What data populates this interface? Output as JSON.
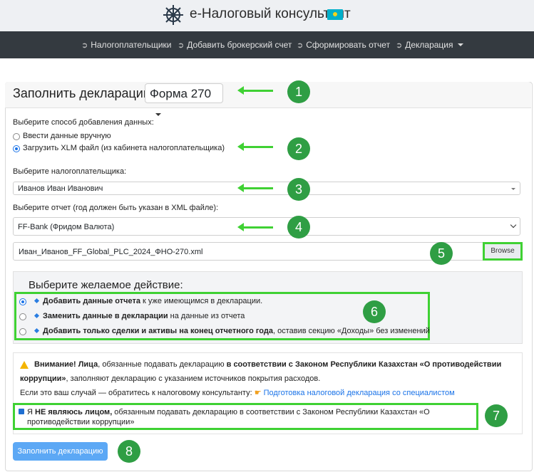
{
  "header": {
    "app_title": "e-Налоговый консультант"
  },
  "nav": {
    "items": [
      {
        "label": "Налогоплательщики"
      },
      {
        "label": "Добавить брокерский счет"
      },
      {
        "label": "Сформировать отчет"
      },
      {
        "label": "Декларация"
      }
    ]
  },
  "form": {
    "title": "Заполнить декларацию",
    "form_select": "Форма 270",
    "data_method_label": "Выберите способ добавления данных:",
    "method_options": [
      {
        "label": "Ввести данные вручную",
        "selected": false
      },
      {
        "label": "Загрузить XLM файл (из кабинета налогоплательщика)",
        "selected": true
      }
    ],
    "taxpayer_label": "Выберите налогоплательщика:",
    "taxpayer_value": "Иванов Иван Иванович",
    "report_label": "Выберите отчет (год должен быть указан в XML файле):",
    "report_value": "FF-Bank (Фридом Валюта)",
    "file_name": "Иван_Иванов_FF_Global_PLC_2024_ФНО-270.xml",
    "browse_label": "Browse"
  },
  "actions": {
    "title": "Выберите желаемое действие:",
    "options": [
      {
        "bold": "Добавить данные отчета",
        "rest": " к уже имеющимся в декларации.",
        "selected": true
      },
      {
        "bold": "Заменить данные в декларации",
        "rest": " на данные из отчета",
        "selected": false
      },
      {
        "bold": "Добавить только сделки и активы на конец отчетного года",
        "rest": ", оставив секцию «Доходы» без изменений",
        "selected": false
      }
    ]
  },
  "warning": {
    "bold1": "Внимание! Лица",
    "text1": ", обязанные подавать декларацию ",
    "bold2": "в соответствии с Законом Республики Казахстан «О противодействии коррупции»",
    "text2": ", заполняют декларацию с указанием источников покрытия расходов.",
    "line2": "Если это ваш случай — обратитесь к налоговому консультанту:",
    "link": "Подготовка налоговой декларация со специалистом",
    "check_prefix": "Я ",
    "check_bold": "НЕ являюсь лицом,",
    "check_rest": " обязанным подавать декларацию в соответствии с Законом Республики Казахстан «О противодействии коррупции»"
  },
  "submit_label": "Заполнить декларацию",
  "annotations": [
    "1",
    "2",
    "3",
    "4",
    "5",
    "6",
    "7",
    "8"
  ],
  "colors": {
    "accent_green": "#3fd133",
    "badge_green": "#2f9e44",
    "nav_bg": "#343a40",
    "primary_button": "#5ca8f5"
  }
}
